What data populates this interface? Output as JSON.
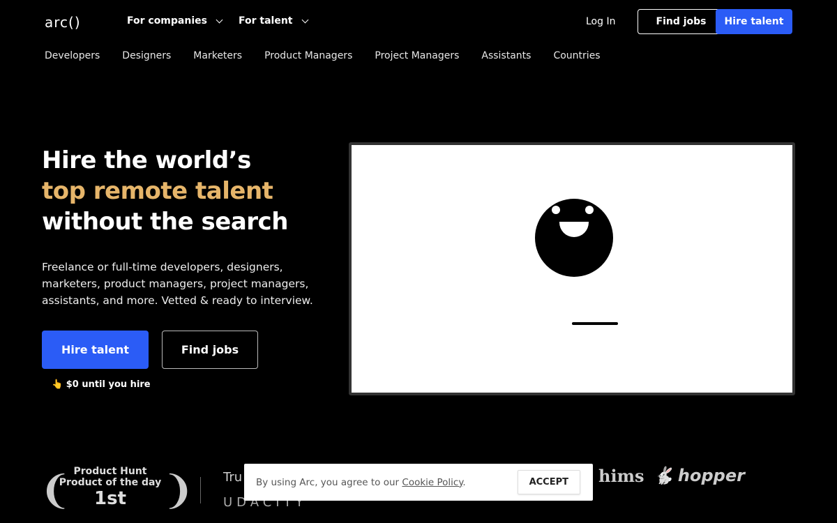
{
  "header": {
    "logo": "arc()",
    "nav": [
      {
        "label": "For companies"
      },
      {
        "label": "For talent"
      }
    ],
    "login": "Log In",
    "find_jobs": "Find jobs",
    "hire_talent": "Hire talent"
  },
  "subnav": [
    "Developers",
    "Designers",
    "Marketers",
    "Product Managers",
    "Project Managers",
    "Assistants",
    "Countries"
  ],
  "hero": {
    "line1": "Hire the world’s",
    "line2": "top remote talent",
    "line3": "without the search",
    "description": "Freelance or full-time developers, designers, marketers, product managers, project managers, assistants, and more. Vetted & ready to interview.",
    "hire_button": "Hire talent",
    "find_button": "Find jobs",
    "note_icon": "👆",
    "note": "$0 until you hire"
  },
  "badges": {
    "ph_line1": "Product Hunt",
    "ph_line2": "Product of the day",
    "ph_rank": "1st",
    "trusted_partial": "Tru",
    "logos": [
      "UDACITY",
      "hims",
      "hopper"
    ]
  },
  "cookie": {
    "text": "By using Arc, you agree to our ",
    "link": "Cookie Policy",
    "period": ".",
    "accept": "ACCEPT"
  },
  "colors": {
    "accent": "#2b5cf6",
    "gold": "#e6b56a",
    "background": "#000000"
  }
}
